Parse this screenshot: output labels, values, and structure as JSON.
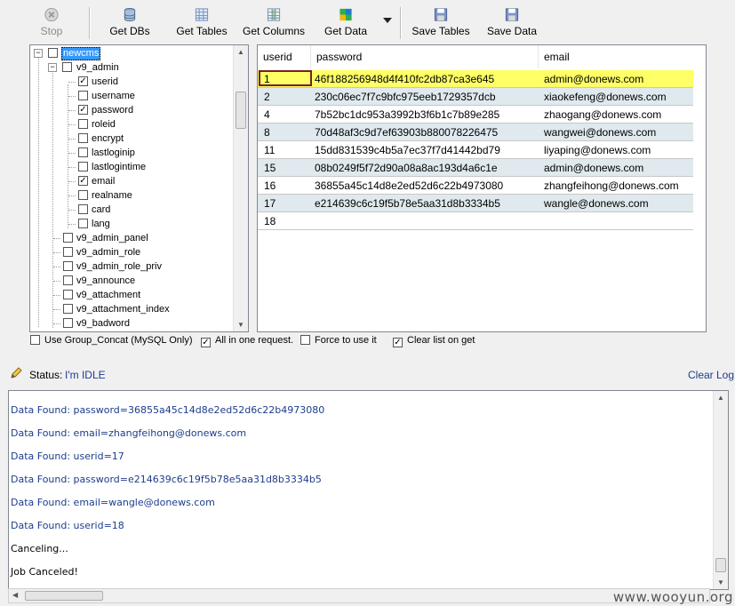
{
  "toolbar": {
    "stop": "Stop",
    "get_dbs": "Get DBs",
    "get_tables": "Get Tables",
    "get_columns": "Get Columns",
    "get_data": "Get Data",
    "save_tables": "Save Tables",
    "save_data": "Save Data"
  },
  "tree": {
    "db": "newcms",
    "table": "v9_admin",
    "columns": [
      {
        "name": "userid",
        "checked": true
      },
      {
        "name": "username",
        "checked": false
      },
      {
        "name": "password",
        "checked": true
      },
      {
        "name": "roleid",
        "checked": false
      },
      {
        "name": "encrypt",
        "checked": false
      },
      {
        "name": "lastloginip",
        "checked": false
      },
      {
        "name": "lastlogintime",
        "checked": false
      },
      {
        "name": "email",
        "checked": true
      },
      {
        "name": "realname",
        "checked": false
      },
      {
        "name": "card",
        "checked": false
      },
      {
        "name": "lang",
        "checked": false
      }
    ],
    "other_tables": [
      "v9_admin_panel",
      "v9_admin_role",
      "v9_admin_role_priv",
      "v9_announce",
      "v9_attachment",
      "v9_attachment_index",
      "v9_badword"
    ]
  },
  "grid": {
    "headers": [
      "userid",
      "password",
      "email"
    ],
    "rows": [
      [
        "1",
        "46f188256948d4f410fc2db87ca3e645",
        "admin@donews.com"
      ],
      [
        "2",
        "230c06ec7f7c9bfc975eeb1729357dcb",
        "xiaokefeng@donews.com"
      ],
      [
        "4",
        "7b52bc1dc953a3992b3f6b1c7b89e285",
        "zhaogang@donews.com"
      ],
      [
        "8",
        "70d48af3c9d7ef63903b880078226475",
        "wangwei@donews.com"
      ],
      [
        "11",
        "15dd831539c4b5a7ec37f7d41442bd79",
        "liyaping@donews.com"
      ],
      [
        "15",
        "08b0249f5f72d90a08a8ac193d4a6c1e",
        "admin@donews.com"
      ],
      [
        "16",
        "36855a45c14d8e2ed52d6c22b4973080",
        "zhangfeihong@donews.com"
      ],
      [
        "17",
        "e214639c6c19f5b78e5aa31d8b3334b5",
        "wangle@donews.com"
      ],
      [
        "18",
        "",
        ""
      ]
    ]
  },
  "options": {
    "group_concat": "Use Group_Concat (MySQL Only)",
    "all_in_one": "All in one request.",
    "force": "Force to use it",
    "clear_list": "Clear list on get"
  },
  "status": {
    "label": "Status:",
    "value": "I'm IDLE",
    "clear_log": "Clear Log"
  },
  "log": [
    "Data Found: password=36855a45c14d8e2ed52d6c22b4973080",
    "Data Found: email=zhangfeihong@donews.com",
    "Data Found: userid=17",
    "Data Found: password=e214639c6c19f5b78e5aa31d8b3334b5",
    "Data Found: email=wangle@donews.com",
    "Data Found: userid=18",
    "Canceling...",
    "Job Canceled!"
  ],
  "watermark": "www.wooyun.org"
}
